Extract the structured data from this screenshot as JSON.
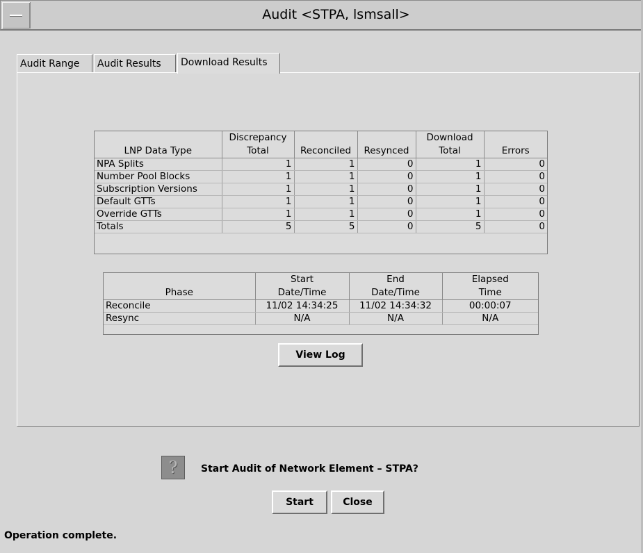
{
  "window": {
    "title": "Audit <STPA, lsmsall>"
  },
  "tabs": [
    {
      "label": "Audit Range"
    },
    {
      "label": "Audit Results"
    },
    {
      "label": "Download Results"
    }
  ],
  "active_tab": "Download Results",
  "lnp_table": {
    "headers": {
      "type": "LNP Data Type",
      "disc1": "Discrepancy",
      "disc2": "Total",
      "reconciled": "Reconciled",
      "resynced": "Resynced",
      "dl1": "Download",
      "dl2": "Total",
      "errors": "Errors"
    },
    "rows": [
      {
        "type": "NPA Splits",
        "discrepancy_total": "1",
        "reconciled": "1",
        "resynced": "0",
        "download_total": "1",
        "errors": "0"
      },
      {
        "type": "Number Pool Blocks",
        "discrepancy_total": "1",
        "reconciled": "1",
        "resynced": "0",
        "download_total": "1",
        "errors": "0"
      },
      {
        "type": "Subscription Versions",
        "discrepancy_total": "1",
        "reconciled": "1",
        "resynced": "0",
        "download_total": "1",
        "errors": "0"
      },
      {
        "type": "Default GTTs",
        "discrepancy_total": "1",
        "reconciled": "1",
        "resynced": "0",
        "download_total": "1",
        "errors": "0"
      },
      {
        "type": "Override GTTs",
        "discrepancy_total": "1",
        "reconciled": "1",
        "resynced": "0",
        "download_total": "1",
        "errors": "0"
      },
      {
        "type": "Totals",
        "discrepancy_total": "5",
        "reconciled": "5",
        "resynced": "0",
        "download_total": "5",
        "errors": "0"
      }
    ]
  },
  "phase_table": {
    "headers": {
      "phase": "Phase",
      "start1": "Start",
      "start2": "Date/Time",
      "end1": "End",
      "end2": "Date/Time",
      "el1": "Elapsed",
      "el2": "Time"
    },
    "rows": [
      {
        "phase": "Reconcile",
        "start": "11/02 14:34:25",
        "end": "11/02 14:34:32",
        "elapsed": "00:00:07"
      },
      {
        "phase": "Resync",
        "start": "N/A",
        "end": "N/A",
        "elapsed": "N/A"
      }
    ]
  },
  "buttons": {
    "view_log": "View Log",
    "start": "Start",
    "close": "Close"
  },
  "prompt": {
    "icon": "question-icon",
    "text": "Start Audit of Network Element – STPA?"
  },
  "status": "Operation complete."
}
